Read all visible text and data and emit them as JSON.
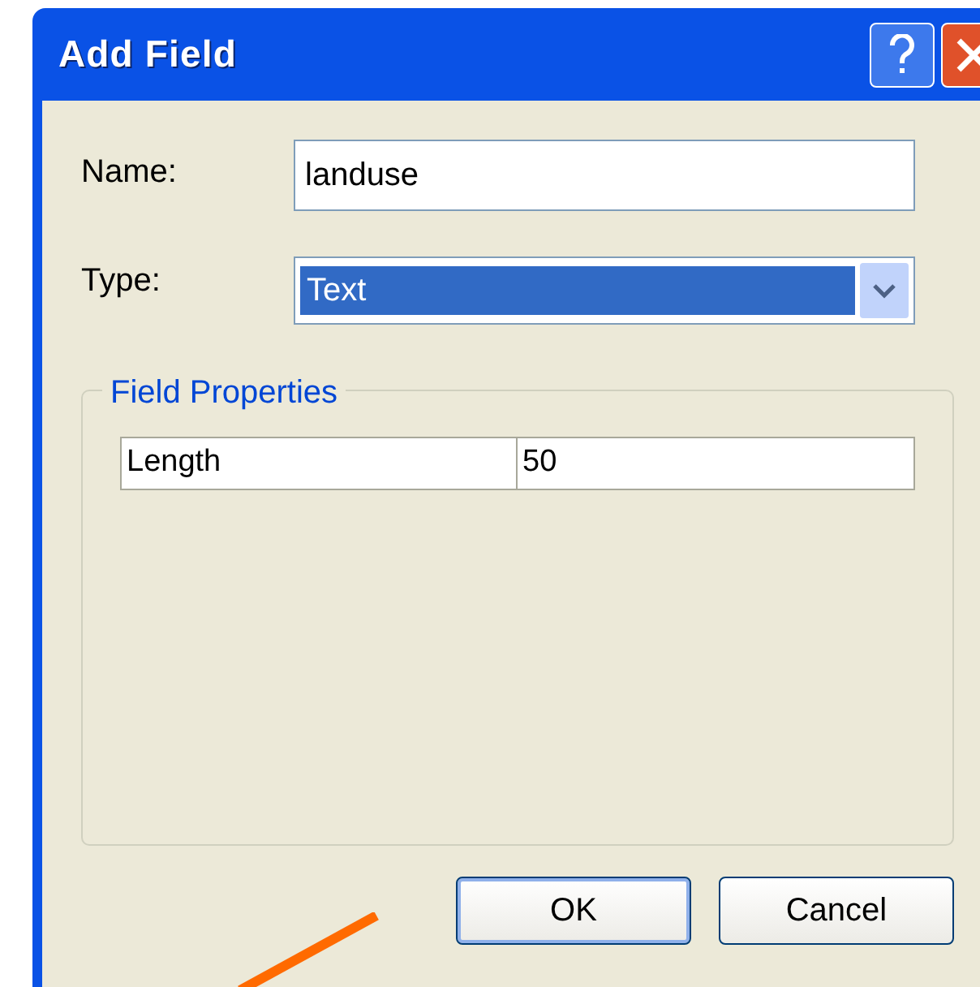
{
  "window": {
    "title": "Add Field"
  },
  "name_field": {
    "label": "Name:",
    "value": "landuse"
  },
  "type_field": {
    "label": "Type:",
    "value": "Text",
    "focused": true
  },
  "field_properties": {
    "title": "Field Properties",
    "rows": [
      {
        "property": "Length",
        "value": "50"
      }
    ]
  },
  "buttons": [
    {
      "label": "OK",
      "default": true
    },
    {
      "label": "Cancel",
      "default": false
    }
  ]
}
